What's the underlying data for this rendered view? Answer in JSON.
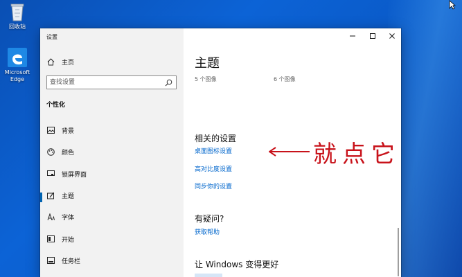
{
  "desktop": {
    "icons": [
      {
        "label": "回收站",
        "icon": "recycle-bin-icon"
      },
      {
        "label": "Microsoft Edge",
        "icon": "edge-icon"
      }
    ]
  },
  "window": {
    "title": "设置",
    "controls": {
      "minimize": "minimize-icon",
      "maximize": "maximize-icon",
      "close": "close-icon"
    }
  },
  "sidebar": {
    "home_label": "主页",
    "search_placeholder": "查找设置",
    "section_title": "个性化",
    "items": [
      {
        "label": "背景",
        "icon": "picture-icon"
      },
      {
        "label": "颜色",
        "icon": "palette-icon"
      },
      {
        "label": "锁屏界面",
        "icon": "lock-screen-icon"
      },
      {
        "label": "主题",
        "icon": "theme-brush-icon",
        "selected": true
      },
      {
        "label": "字体",
        "icon": "font-icon"
      },
      {
        "label": "开始",
        "icon": "start-menu-icon"
      },
      {
        "label": "任务栏",
        "icon": "taskbar-icon"
      }
    ]
  },
  "main": {
    "title": "主题",
    "theme_counts": [
      "5 个图像",
      "6 个图像"
    ],
    "related_title": "相关的设置",
    "related_links": [
      "桌面图标设置",
      "高对比度设置",
      "同步你的设置"
    ],
    "annotation": "就点它",
    "help_title": "有疑问?",
    "help_link": "获取帮助",
    "improve_title": "让 Windows 变得更好"
  },
  "colors": {
    "accent": "#0063b1",
    "link": "#0066cc",
    "annotation": "#c8121a"
  }
}
